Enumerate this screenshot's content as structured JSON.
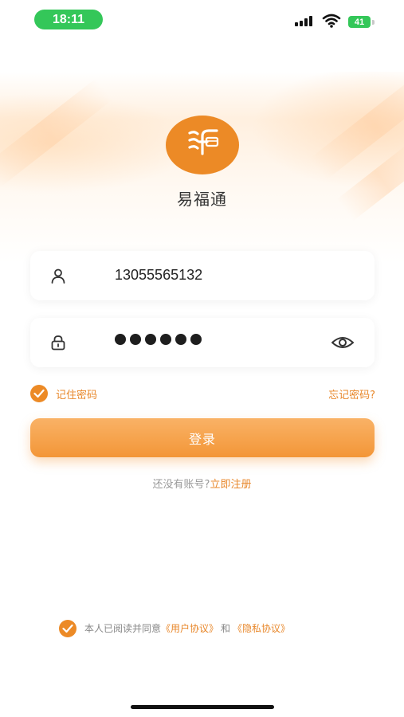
{
  "status_bar": {
    "time": "18:11",
    "battery": "41"
  },
  "app": {
    "name": "易福通"
  },
  "login_form": {
    "phone_value": "13055565132",
    "password_masked_length": 6,
    "remember_label": "记住密码",
    "remember_checked": true,
    "forgot_label": "忘记密码?",
    "login_label": "登录"
  },
  "register": {
    "prompt": "还没有账号?",
    "link": "立即注册"
  },
  "agreement": {
    "checked": true,
    "prefix": "本人已阅读并同意",
    "user_agreement": "《用户协议》",
    "conjunction": "和",
    "privacy_policy": "《隐私协议》"
  },
  "colors": {
    "accent": "#ec8a26",
    "link": "#e8872a",
    "status_green": "#34c759"
  },
  "icons": [
    "user-icon",
    "lock-icon",
    "eye-icon",
    "checkmark-icon",
    "wifi-icon",
    "signal-icon",
    "battery-icon"
  ]
}
